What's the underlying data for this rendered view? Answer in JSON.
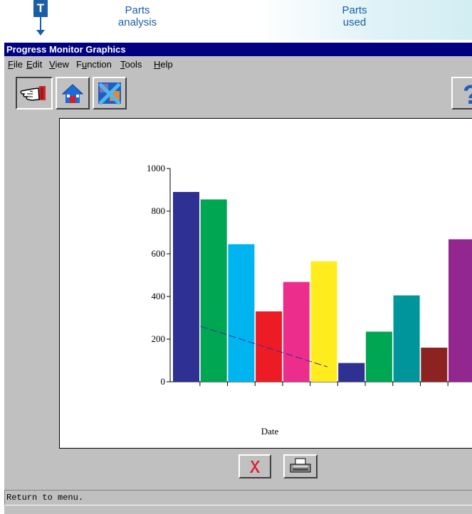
{
  "annotations": {
    "marker_label": "T",
    "parts_analysis": [
      "Parts",
      "analysis"
    ],
    "parts_used": [
      "Parts",
      "used"
    ]
  },
  "window": {
    "title": "Progress Monitor Graphics"
  },
  "menu": [
    {
      "label": "File",
      "underline": "F",
      "rest": "ile"
    },
    {
      "label": "Edit",
      "underline": "E",
      "rest": "dit"
    },
    {
      "label": "View",
      "underline": "V",
      "rest": "iew"
    },
    {
      "label": "Function",
      "underline": "u",
      "pre": "F",
      "rest": "nction"
    },
    {
      "label": "Tools",
      "underline": "T",
      "rest": "ools"
    },
    {
      "label": "Help",
      "underline": "H",
      "rest": "elp"
    }
  ],
  "toolbar": {
    "buttons": [
      "pointing-hand-icon",
      "home-icon",
      "no-function-icon",
      "help-icon"
    ]
  },
  "bottom_buttons": [
    "cancel-x-icon",
    "printer-icon"
  ],
  "status": {
    "text": "Return to menu."
  },
  "chart_data": {
    "type": "bar",
    "xlabel": "Date",
    "ylabel": "",
    "ylim": [
      0,
      1000
    ],
    "yticks": [
      0,
      200,
      400,
      600,
      800,
      1000
    ],
    "values": [
      890,
      855,
      645,
      330,
      468,
      565,
      88,
      235,
      405,
      160,
      668
    ],
    "colors": [
      "#2e3192",
      "#00a651",
      "#00b4ef",
      "#ed1c24",
      "#ec2d8c",
      "#ffec1f",
      "#2e3192",
      "#00a651",
      "#00959a",
      "#8b2323",
      "#92278f"
    ],
    "trend_line": {
      "from": [
        1,
        260
      ],
      "to": [
        5.6,
        70
      ],
      "color": "#2e3192",
      "style": "dashed"
    }
  },
  "colors": {
    "accent": "#1a5ea8",
    "titlebar": "#000080",
    "window": "#c0c0c0"
  }
}
